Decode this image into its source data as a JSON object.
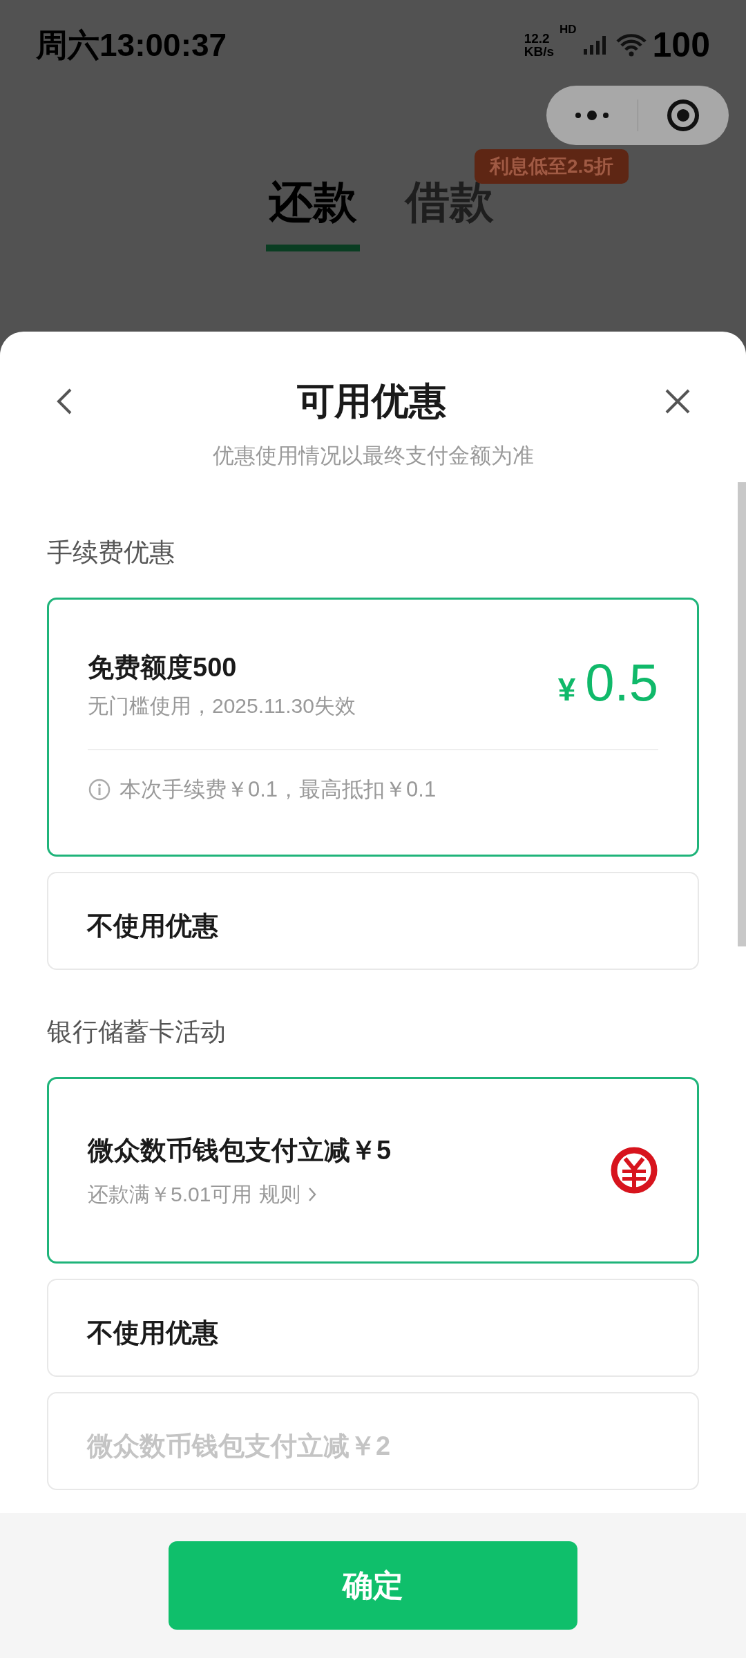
{
  "status_bar": {
    "time": "周六13:00:37",
    "speed_value": "12.2",
    "speed_unit": "KB/s",
    "network": "HD",
    "battery": "100"
  },
  "background": {
    "tabs": [
      {
        "label": "还款",
        "selected": true
      },
      {
        "label": "借款",
        "selected": false
      }
    ],
    "badge": "利息低至2.5折"
  },
  "sheet": {
    "title": "可用优惠",
    "subtitle": "优惠使用情况以最终支付金额为准",
    "sections": [
      {
        "heading": "手续费优惠",
        "items": [
          {
            "kind": "coupon",
            "selected": true,
            "disabled": false,
            "title": "免费额度500",
            "detail": "无门槛使用，2025.11.30失效",
            "currency": "¥",
            "amount": "0.5",
            "note": "本次手续费￥0.1，最高抵扣￥0.1"
          },
          {
            "kind": "none",
            "selected": false,
            "disabled": false,
            "title": "不使用优惠"
          }
        ]
      },
      {
        "heading": "银行储蓄卡活动",
        "items": [
          {
            "kind": "bank",
            "selected": true,
            "disabled": false,
            "title": "微众数币钱包支付立减￥5",
            "detail": "还款满￥5.01可用",
            "link": "规则"
          },
          {
            "kind": "none",
            "selected": false,
            "disabled": false,
            "title": "不使用优惠"
          },
          {
            "kind": "none",
            "selected": false,
            "disabled": true,
            "title": "微众数币钱包支付立减￥2"
          }
        ]
      }
    ]
  },
  "confirm_button": "确定"
}
